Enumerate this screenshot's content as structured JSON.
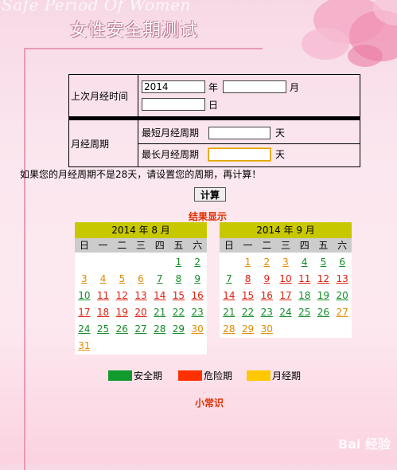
{
  "header": {
    "bg_text": "Safe Period Of Women",
    "title": "女性安全期测试"
  },
  "form": {
    "last_period_label": "上次月经时间",
    "year_value": "2014",
    "year_unit": "年",
    "month_unit": "月",
    "day_unit": "日",
    "cycle_label": "月经周期",
    "shortest_label": "最短月经周期",
    "longest_label": "最长月经周期",
    "day_suffix": "天"
  },
  "notice": "如果您的月经周期不是28天，请设置您的周期，再计算！",
  "calc_button": "计算",
  "result_title": "结果显示",
  "weekdays": [
    "日",
    "一",
    "二",
    "三",
    "四",
    "五",
    "六"
  ],
  "calendars": [
    {
      "title": "2014 年 8 月",
      "offset": 5,
      "days": [
        {
          "d": "1",
          "t": "safe"
        },
        {
          "d": "2",
          "t": "safe"
        },
        {
          "d": "3",
          "t": "period"
        },
        {
          "d": "4",
          "t": "period"
        },
        {
          "d": "5",
          "t": "period"
        },
        {
          "d": "6",
          "t": "period"
        },
        {
          "d": "7",
          "t": "safe"
        },
        {
          "d": "8",
          "t": "safe"
        },
        {
          "d": "9",
          "t": "safe"
        },
        {
          "d": "10",
          "t": "safe"
        },
        {
          "d": "11",
          "t": "danger"
        },
        {
          "d": "12",
          "t": "danger"
        },
        {
          "d": "13",
          "t": "danger"
        },
        {
          "d": "14",
          "t": "danger"
        },
        {
          "d": "15",
          "t": "danger"
        },
        {
          "d": "16",
          "t": "danger"
        },
        {
          "d": "17",
          "t": "danger"
        },
        {
          "d": "18",
          "t": "danger"
        },
        {
          "d": "19",
          "t": "danger"
        },
        {
          "d": "20",
          "t": "danger"
        },
        {
          "d": "21",
          "t": "safe"
        },
        {
          "d": "22",
          "t": "safe"
        },
        {
          "d": "23",
          "t": "safe"
        },
        {
          "d": "24",
          "t": "safe"
        },
        {
          "d": "25",
          "t": "safe"
        },
        {
          "d": "26",
          "t": "safe"
        },
        {
          "d": "27",
          "t": "safe"
        },
        {
          "d": "28",
          "t": "safe"
        },
        {
          "d": "29",
          "t": "safe"
        },
        {
          "d": "30",
          "t": "period"
        },
        {
          "d": "31",
          "t": "period"
        }
      ]
    },
    {
      "title": "2014 年 9 月",
      "offset": 1,
      "days": [
        {
          "d": "1",
          "t": "period"
        },
        {
          "d": "2",
          "t": "period"
        },
        {
          "d": "3",
          "t": "period"
        },
        {
          "d": "4",
          "t": "safe"
        },
        {
          "d": "5",
          "t": "safe"
        },
        {
          "d": "6",
          "t": "safe"
        },
        {
          "d": "7",
          "t": "safe"
        },
        {
          "d": "8",
          "t": "danger"
        },
        {
          "d": "9",
          "t": "danger"
        },
        {
          "d": "10",
          "t": "danger"
        },
        {
          "d": "11",
          "t": "danger"
        },
        {
          "d": "12",
          "t": "danger"
        },
        {
          "d": "13",
          "t": "danger"
        },
        {
          "d": "14",
          "t": "danger"
        },
        {
          "d": "15",
          "t": "danger"
        },
        {
          "d": "16",
          "t": "danger"
        },
        {
          "d": "17",
          "t": "danger"
        },
        {
          "d": "18",
          "t": "safe"
        },
        {
          "d": "19",
          "t": "safe"
        },
        {
          "d": "20",
          "t": "safe"
        },
        {
          "d": "21",
          "t": "safe"
        },
        {
          "d": "22",
          "t": "safe"
        },
        {
          "d": "23",
          "t": "safe"
        },
        {
          "d": "24",
          "t": "safe"
        },
        {
          "d": "25",
          "t": "safe"
        },
        {
          "d": "26",
          "t": "safe"
        },
        {
          "d": "27",
          "t": "period"
        },
        {
          "d": "28",
          "t": "period"
        },
        {
          "d": "29",
          "t": "period"
        },
        {
          "d": "30",
          "t": "period"
        }
      ]
    }
  ],
  "legend": [
    {
      "label": "安全期",
      "color": "#129a2c"
    },
    {
      "label": "危险期",
      "color": "#ff3000"
    },
    {
      "label": "月经期",
      "color": "#ffc800"
    }
  ],
  "tips_title": "小常识",
  "watermark": "Bai 经验"
}
